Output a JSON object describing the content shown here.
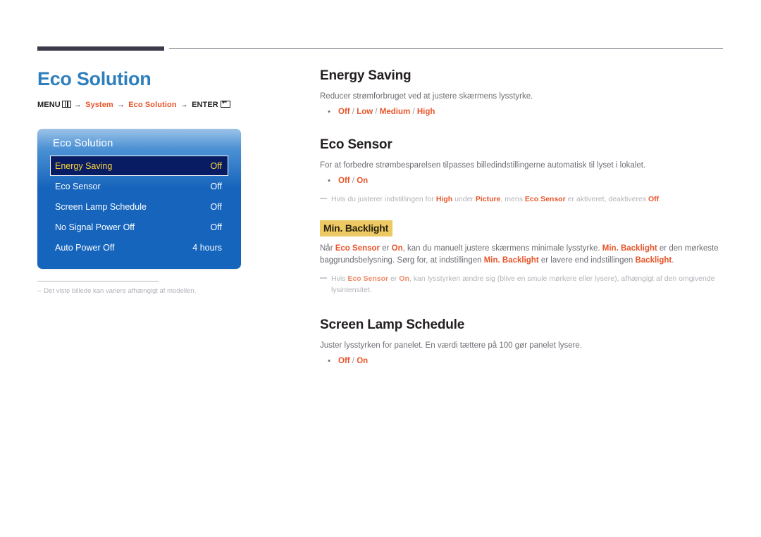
{
  "page": {
    "title": "Eco Solution",
    "breadcrumb": {
      "menu_label": "MENU",
      "menu_icon": "menu-grid-icon",
      "arrow": "→",
      "step1": "System",
      "step2": "Eco Solution",
      "enter_label": "ENTER",
      "enter_icon": "enter-return-icon"
    },
    "footnote": {
      "dash": "–",
      "text": "Det viste billede kan variere afhængigt af modellen."
    }
  },
  "osd": {
    "title": "Eco Solution",
    "rows": [
      {
        "label": "Energy Saving",
        "value": "Off",
        "selected": true
      },
      {
        "label": "Eco Sensor",
        "value": "Off",
        "selected": false
      },
      {
        "label": "Screen Lamp Schedule",
        "value": "Off",
        "selected": false
      },
      {
        "label": "No Signal Power Off",
        "value": "Off",
        "selected": false
      },
      {
        "label": "Auto Power Off",
        "value": "4 hours",
        "selected": false
      }
    ]
  },
  "sections": {
    "energy_saving": {
      "heading": "Energy Saving",
      "body": "Reducer strømforbruget ved at justere skærmens lysstyrke.",
      "options": [
        "Off",
        "Low",
        "Medium",
        "High"
      ],
      "options_text": "Off / Low / Medium / High"
    },
    "eco_sensor": {
      "heading": "Eco Sensor",
      "body": "For at forbedre strømbesparelsen tilpasses billedindstillingerne automatisk til lyset i lokalet.",
      "options": [
        "Off",
        "On"
      ],
      "options_text": "Off / On",
      "note": {
        "p1": "Hvis du justerer indstillingen for ",
        "kw1": "High",
        "p2": " under ",
        "kw2": "Picture",
        "p3": ", mens ",
        "kw3": "Eco Sensor",
        "p4": " er aktiveret, deaktiveres ",
        "kw4": "Off",
        "p5": "."
      }
    },
    "min_backlight": {
      "heading": "Min. Backlight",
      "body": {
        "p1": "Når ",
        "kw1": "Eco Sensor",
        "p2": " er ",
        "kw2": "On",
        "p3": ", kan du manuelt justere skærmens minimale lysstyrke. ",
        "kw3": "Min. Backlight",
        "p4": " er den mørkeste baggrundsbelysning. Sørg for, at indstillingen ",
        "kw4": "Min. Backlight",
        "p5": " er lavere end indstillingen ",
        "kw5": "Backlight",
        "p6": "."
      },
      "note": {
        "p1": "Hvis ",
        "kw1": "Eco Sensor",
        "p2": " er ",
        "kw2": "On",
        "p3": ", kan lysstyrken ændre sig (blive en smule mørkere eller lysere), afhængigt af den omgivende lysintensitet."
      }
    },
    "screen_lamp_schedule": {
      "heading": "Screen Lamp Schedule",
      "body": "Juster lysstyrken for panelet. En værdi tættere på 100 gør panelet lysere.",
      "options": [
        "Off",
        "On"
      ],
      "options_text": "Off / On"
    }
  },
  "colors": {
    "title_blue": "#2f7fbd",
    "accent_orange": "#e8542a",
    "osd_blue": "#1565bd",
    "osd_selected_bg": "#081c64",
    "osd_selected_text": "#ffd83b",
    "highlight_gold": "#ecc963"
  }
}
